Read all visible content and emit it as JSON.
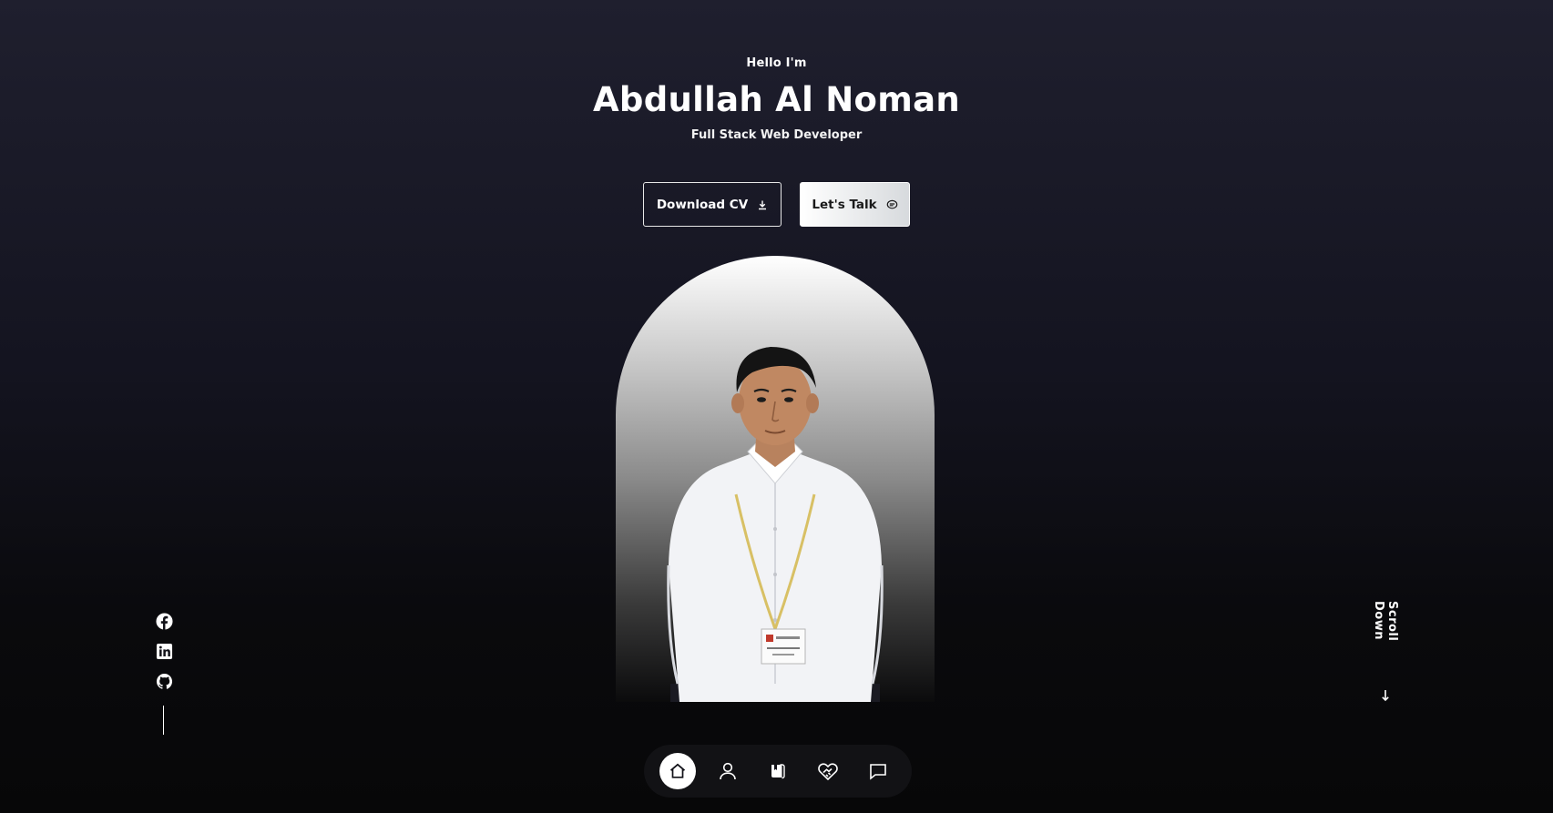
{
  "hero": {
    "greeting": "Hello I'm",
    "name": "Abdullah Al Noman",
    "role": "Full Stack Web Developer"
  },
  "buttons": {
    "download_cv": "Download CV",
    "lets_talk": "Let's Talk"
  },
  "socials": [
    {
      "icon": "facebook-icon"
    },
    {
      "icon": "linkedin-icon"
    },
    {
      "icon": "github-icon"
    }
  ],
  "scroll": {
    "label": "Scroll Down"
  },
  "nav": {
    "items": [
      {
        "icon": "home-icon",
        "active": true
      },
      {
        "icon": "user-icon",
        "active": false
      },
      {
        "icon": "book-icon",
        "active": false
      },
      {
        "icon": "handshake-icon",
        "active": false
      },
      {
        "icon": "message-icon",
        "active": false
      }
    ]
  },
  "colors": {
    "background_top": "#1f1f2e",
    "background_bottom": "#070708",
    "text": "#ffffff",
    "accent": "#ffffff"
  }
}
